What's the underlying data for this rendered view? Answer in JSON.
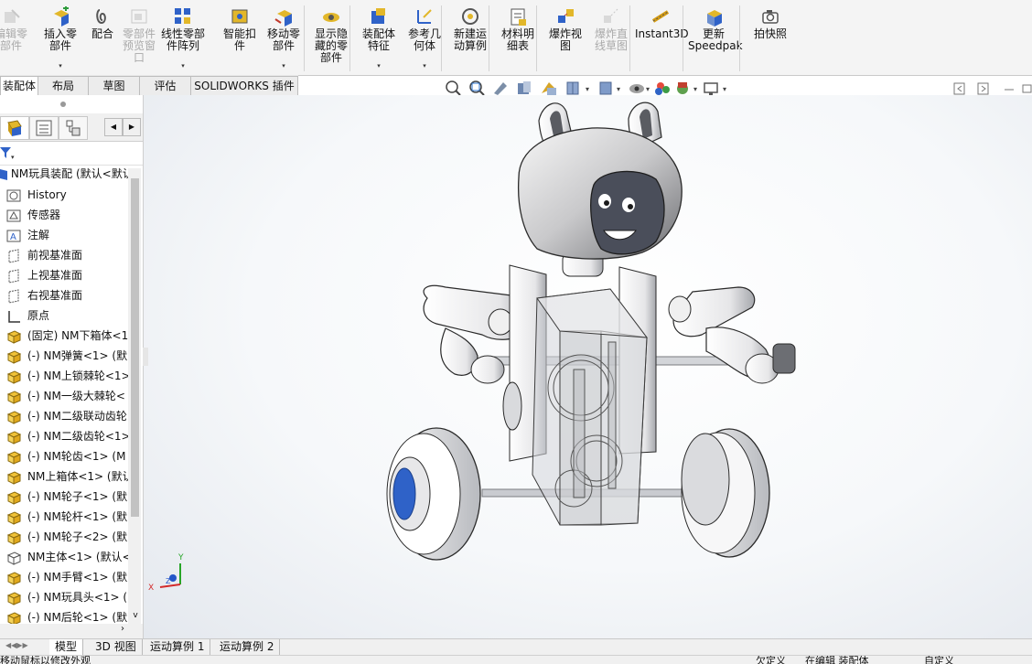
{
  "ribbon": {
    "buttons": [
      {
        "label": "编辑零\n部件",
        "icon": "edit-component-icon",
        "disabled": true
      },
      {
        "label": "插入零\n部件",
        "icon": "insert-component-icon",
        "disabled": false
      },
      {
        "label": "配合",
        "icon": "mate-paperclip-icon",
        "disabled": false
      },
      {
        "label": "零部件\n预览窗\n口",
        "icon": "component-preview-icon",
        "disabled": true
      },
      {
        "label": "线性零部\n件阵列",
        "icon": "linear-pattern-icon",
        "disabled": false
      },
      {
        "label": "智能扣\n件",
        "icon": "smart-fastener-icon",
        "disabled": false
      },
      {
        "label": "移动零\n部件",
        "icon": "move-component-icon",
        "disabled": false
      },
      {
        "label": "显示隐\n藏的零\n部件",
        "icon": "show-hidden-icon",
        "disabled": false
      },
      {
        "label": "装配体\n特征",
        "icon": "assembly-feature-icon",
        "disabled": false
      },
      {
        "label": "参考几\n何体",
        "icon": "reference-geometry-icon",
        "disabled": false
      },
      {
        "label": "新建运\n动算例",
        "icon": "motion-study-icon",
        "disabled": false
      },
      {
        "label": "材料明\n细表",
        "icon": "bom-icon",
        "disabled": false
      },
      {
        "label": "爆炸视\n图",
        "icon": "exploded-view-icon",
        "disabled": false
      },
      {
        "label": "爆炸直\n线草图",
        "icon": "explode-line-sketch-icon",
        "disabled": true
      },
      {
        "label": "Instant3D",
        "icon": "instant3d-icon",
        "disabled": false
      },
      {
        "label": "更新\nSpeedpak",
        "icon": "speedpak-icon",
        "disabled": false
      },
      {
        "label": "拍快照",
        "icon": "camera-icon",
        "disabled": false
      }
    ]
  },
  "tabs": [
    "装配体",
    "布局",
    "草图",
    "评估",
    "SOLIDWORKS 插件"
  ],
  "tree": {
    "root": "NM玩具装配  (默认<默认",
    "items": [
      {
        "label": "History",
        "icon": "history-icon"
      },
      {
        "label": "传感器",
        "icon": "sensor-icon"
      },
      {
        "label": "注解",
        "icon": "annotation-icon"
      },
      {
        "label": "前视基准面",
        "icon": "plane-icon"
      },
      {
        "label": "上视基准面",
        "icon": "plane-icon"
      },
      {
        "label": "右视基准面",
        "icon": "plane-icon"
      },
      {
        "label": "原点",
        "icon": "origin-icon"
      },
      {
        "label": "(固定) NM下箱体<1",
        "icon": "part-icon"
      },
      {
        "label": "(-) NM弹簧<1> (默",
        "icon": "part-icon"
      },
      {
        "label": "(-) NM上锁棘轮<1>",
        "icon": "part-icon"
      },
      {
        "label": "(-) NM一级大棘轮<",
        "icon": "part-icon"
      },
      {
        "label": "(-) NM二级联动齿轮",
        "icon": "part-icon"
      },
      {
        "label": "(-) NM二级齿轮<1>",
        "icon": "part-icon"
      },
      {
        "label": "(-) NM轮齿<1> (M",
        "icon": "part-icon"
      },
      {
        "label": "NM上箱体<1> (默认",
        "icon": "part-icon"
      },
      {
        "label": "(-) NM轮子<1> (默",
        "icon": "part-icon"
      },
      {
        "label": "(-) NM轮杆<1> (默",
        "icon": "part-icon"
      },
      {
        "label": "(-) NM轮子<2> (默",
        "icon": "part-icon"
      },
      {
        "label": "NM主体<1> (默认<",
        "icon": "part-outline-icon"
      },
      {
        "label": "(-) NM手臂<1> (默",
        "icon": "part-icon"
      },
      {
        "label": "(-) NM玩具头<1> (",
        "icon": "part-icon"
      },
      {
        "label": "(-) NM后轮<1> (默",
        "icon": "part-icon"
      }
    ]
  },
  "bottom_tabs": [
    "模型",
    "3D 视图",
    "运动算例 1",
    "运动算例 2"
  ],
  "status": {
    "left": "移动鼠标以修改外观",
    "mid1": "欠定义",
    "mid2": "在编辑 装配体",
    "right": "自定义"
  },
  "triad": {
    "x": "X",
    "y": "Y",
    "z": "Z"
  },
  "colors": {
    "accent": "#1e6fc8",
    "ribbon_bg": "#f4f4f4",
    "wheel_hub": "#2f62c8",
    "face": "#4a4e5a"
  }
}
